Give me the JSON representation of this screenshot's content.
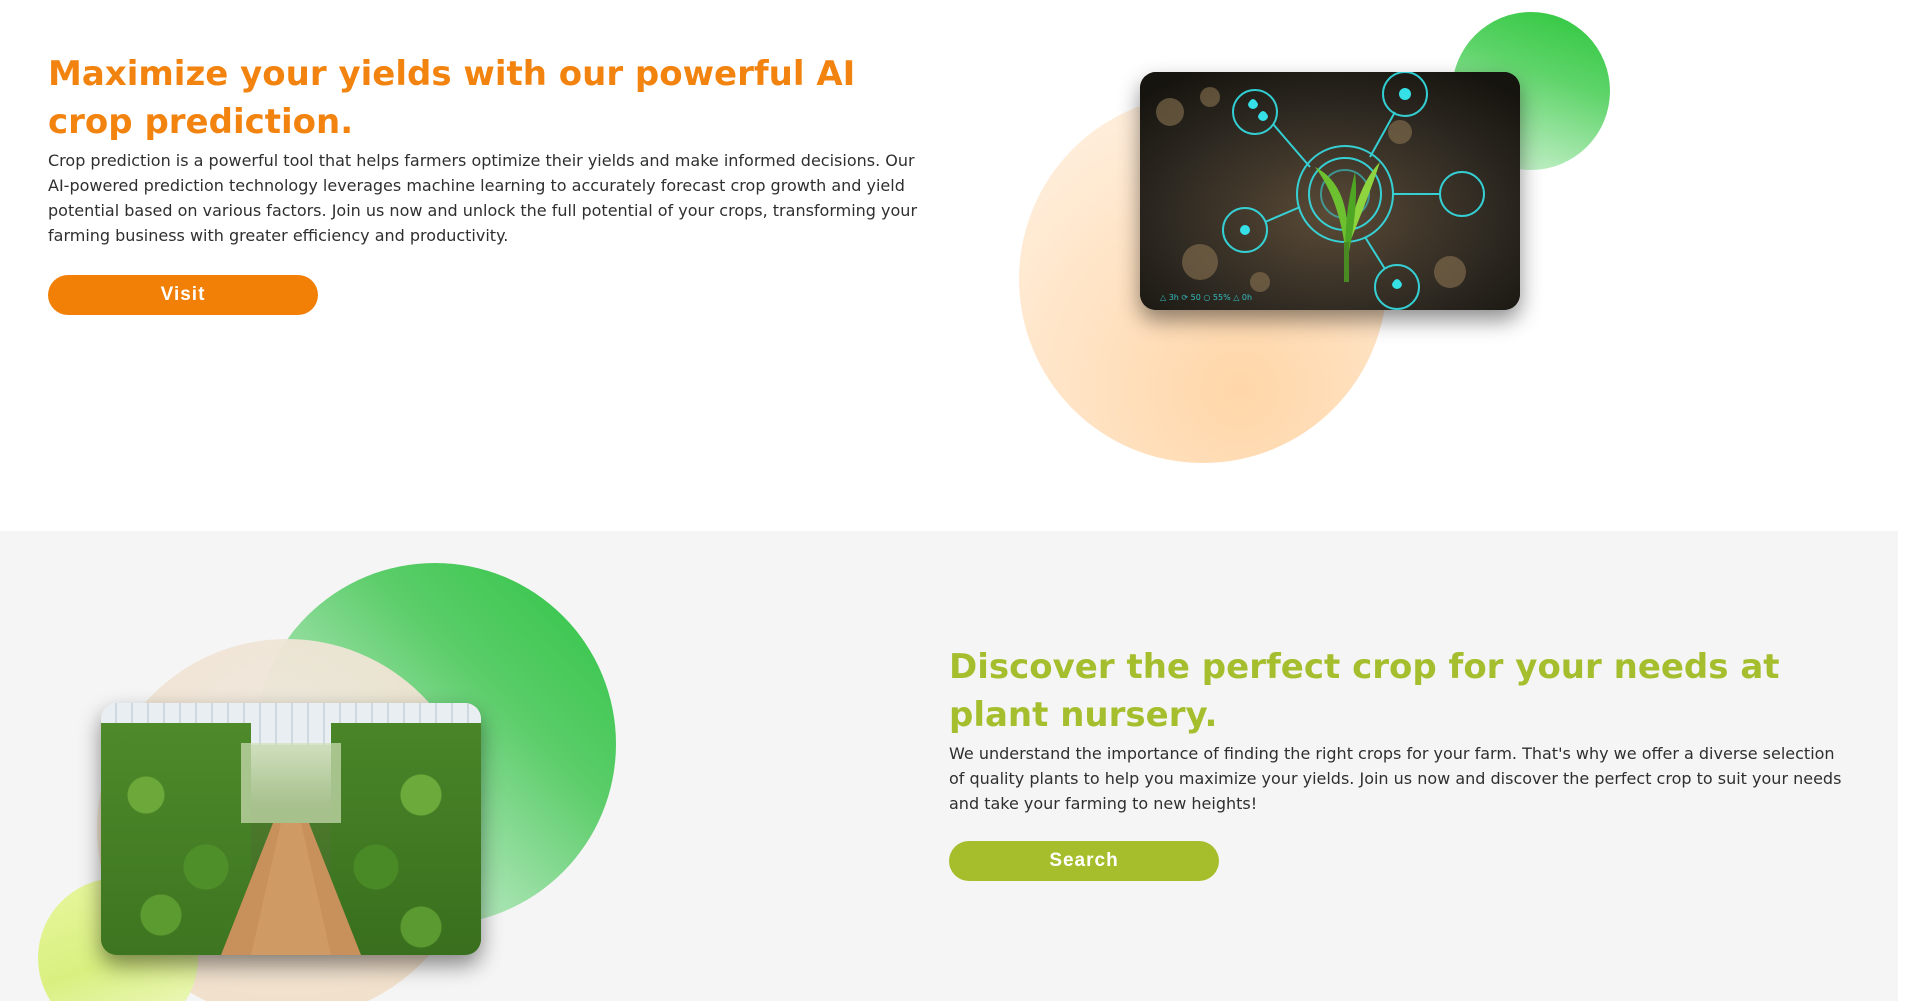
{
  "crop_prediction": {
    "heading": "Maximize your yields with our powerful AI crop prediction.",
    "description": "Crop prediction is a powerful tool that helps farmers optimize their yields and make informed decisions. Our AI-powered prediction technology leverages machine learning to accurately forecast crop growth and yield potential based on various factors. Join us now and unlock the full potential of your crops, transforming your farming business with greater efficiency and productivity.",
    "button_label": "Visit",
    "accent_color": "#f2830f"
  },
  "plant_nursery": {
    "heading": "Discover the perfect crop for your needs at plant nursery.",
    "description": "We understand the importance of finding the right crops for your farm. That's why we offer a diverse selection of quality plants to help you maximize your yields. Join us now and discover the perfect crop to suit your needs and take your farming to new heights!",
    "button_label": "Search",
    "accent_color": "#a5be2e"
  },
  "images": {
    "seedling_icon": "smart-farming-seedling-image",
    "greenhouse_icon": "greenhouse-crops-image"
  }
}
